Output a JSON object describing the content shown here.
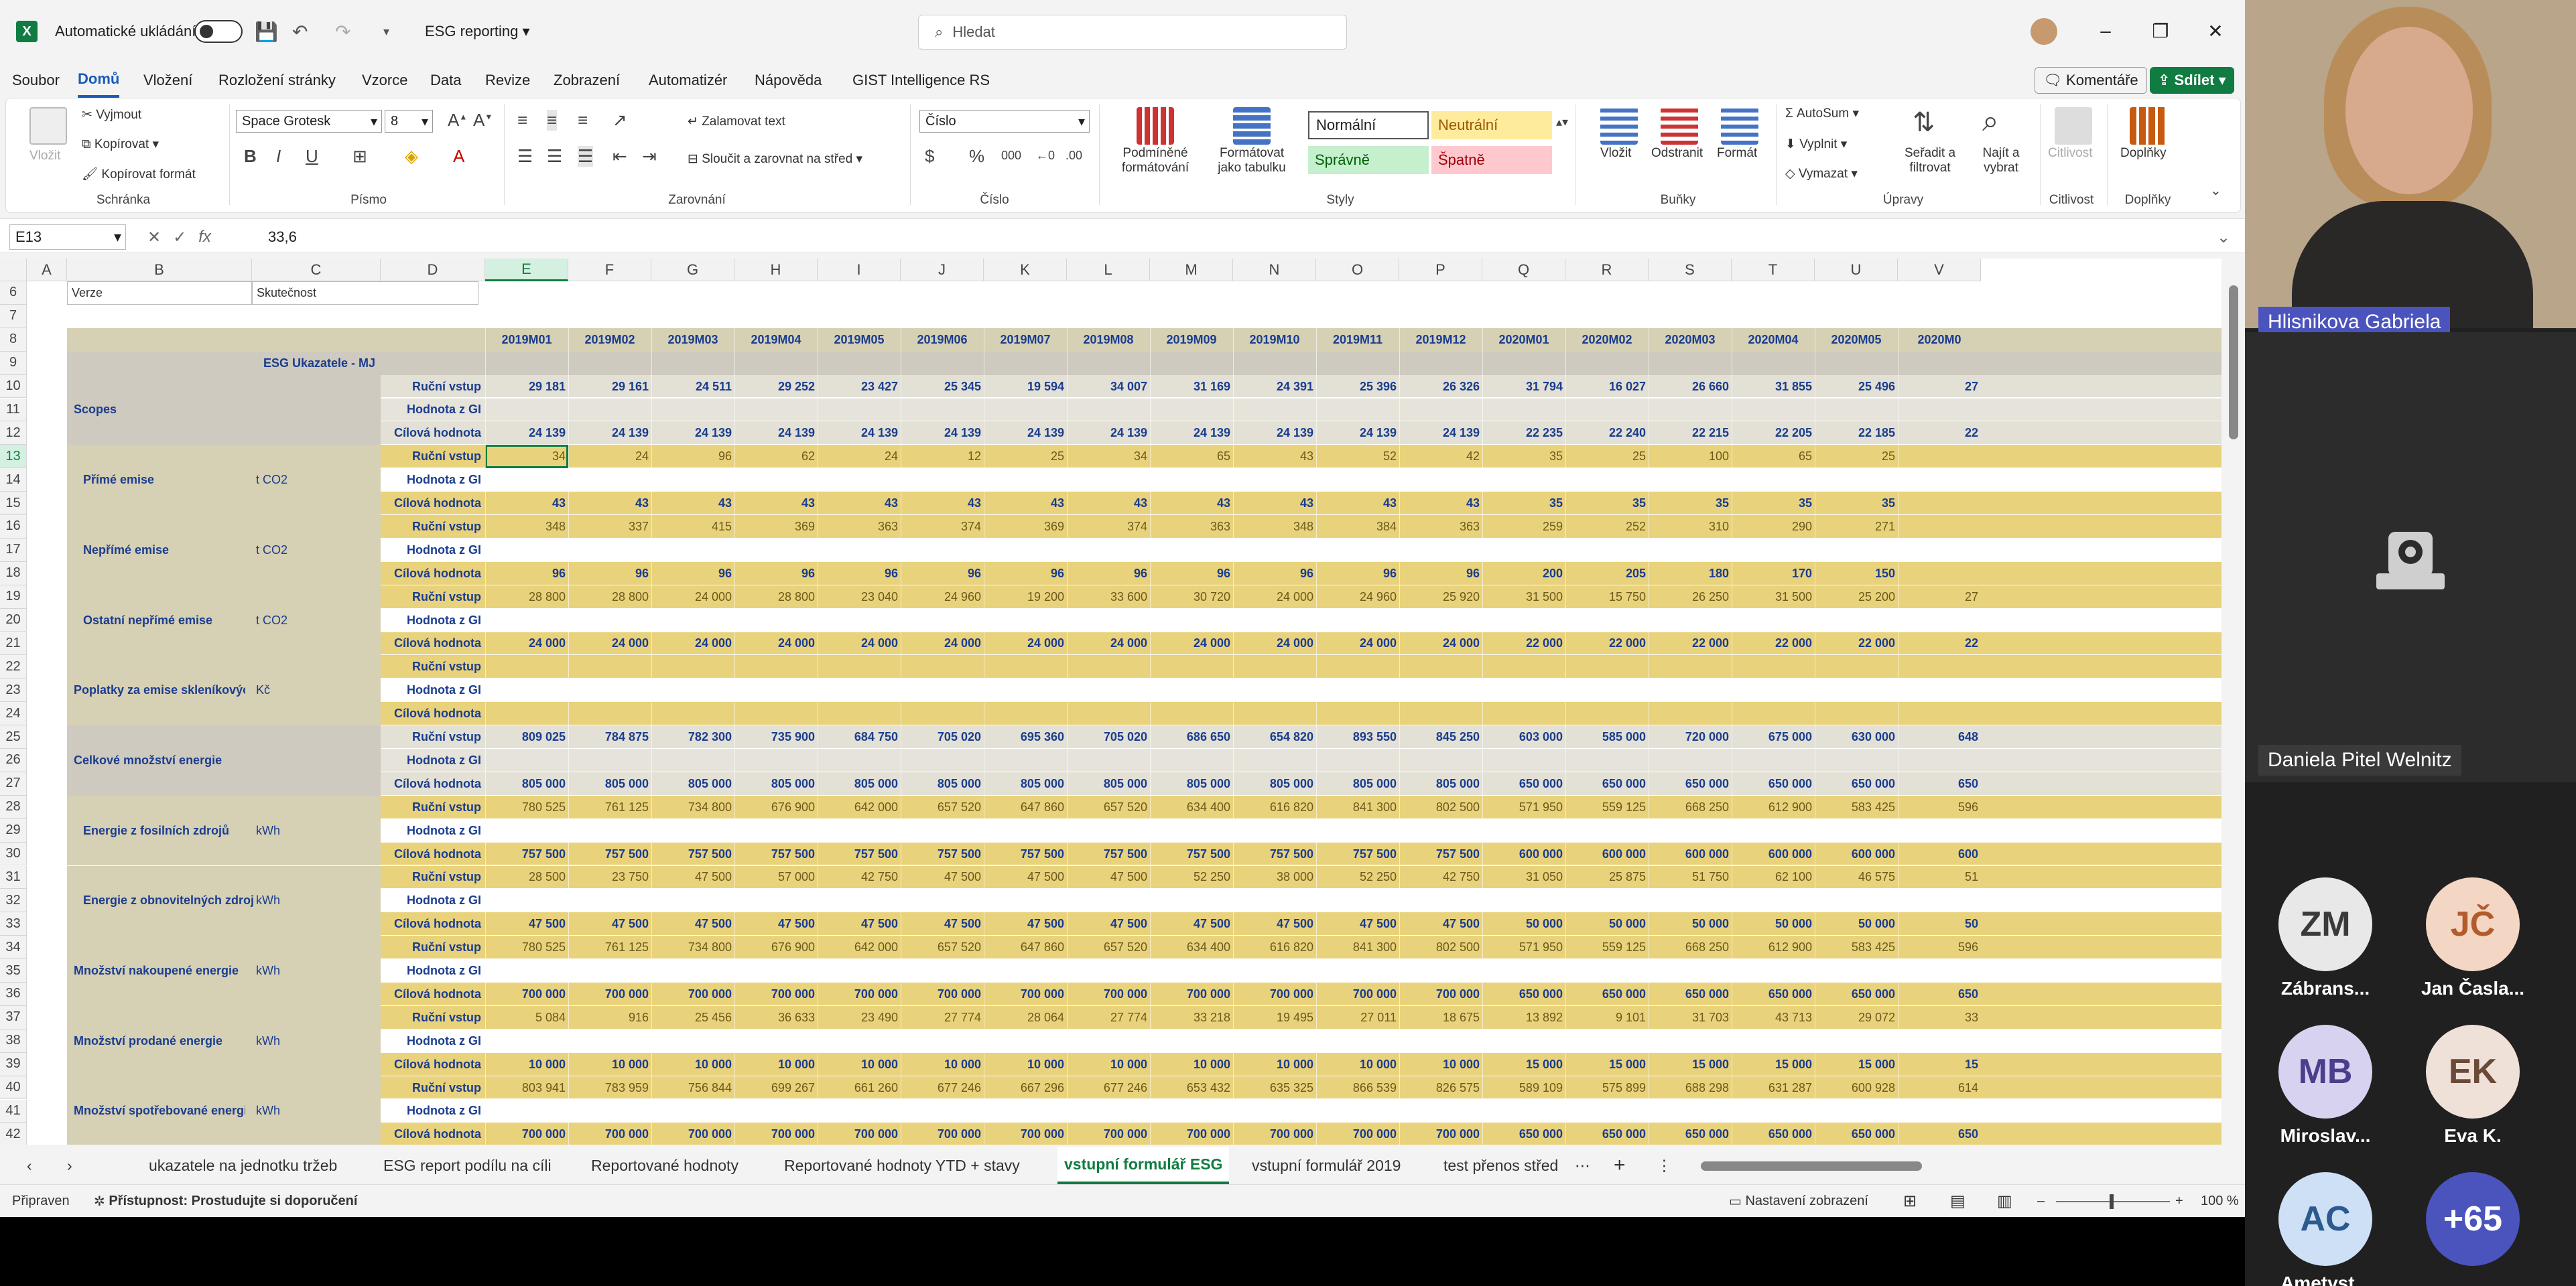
{
  "titlebar": {
    "autosave_label": "Automatické ukládání",
    "doc_title": "ESG reporting",
    "search_placeholder": "Hledat",
    "logo": "X"
  },
  "menu": [
    "Soubor",
    "Domů",
    "Vložení",
    "Rozložení stránky",
    "Vzorce",
    "Data",
    "Revize",
    "Zobrazení",
    "Automatizér",
    "Nápověda",
    "GIST Intelligence RS"
  ],
  "menu_right": {
    "comments": "Komentáře",
    "share": "Sdílet"
  },
  "ribbon": {
    "clipboard": {
      "paste": "Vložit",
      "cut": "Vyjmout",
      "copy": "Kopírovat",
      "format_painter": "Kopírovat formát",
      "group": "Schránka"
    },
    "font": {
      "name": "Space Grotesk",
      "size": "8",
      "group": "Písmo",
      "bold": "B",
      "italic": "I",
      "underline": "U"
    },
    "alignment": {
      "wrap": "Zalamovat text",
      "merge": "Sloučit a zarovnat na střed",
      "group": "Zarovnání"
    },
    "number": {
      "format": "Číslo",
      "currency": "$",
      "percent": "%",
      "thousands": "000",
      "group": "Číslo"
    },
    "styles": {
      "cond_format": "Podmíněné formátování",
      "as_table": "Formátovat jako tabulku",
      "normal": "Normální",
      "neutral": "Neutrální",
      "good": "Správně",
      "bad": "Špatně",
      "group": "Styly"
    },
    "cells": {
      "insert": "Vložit",
      "delete": "Odstranit",
      "format": "Formát",
      "group": "Buňky"
    },
    "editing": {
      "autosum": "AutoSum",
      "fill": "Vyplnit",
      "clear": "Vymazat",
      "sort": "Seřadit a filtrovat",
      "find": "Najít a vybrat",
      "group": "Úpravy"
    },
    "sensitivity": {
      "label": "Citlivost",
      "group": "Citlivost"
    },
    "addins": {
      "label": "Doplňky",
      "group": "Doplňky"
    }
  },
  "formula_bar": {
    "name_box": "E13",
    "fx": "fx",
    "formula": "33,6"
  },
  "grid": {
    "columns": [
      "A",
      "B",
      "C",
      "D",
      "E",
      "F",
      "G",
      "H",
      "I",
      "J",
      "K",
      "L",
      "M",
      "N",
      "O",
      "P",
      "Q",
      "R",
      "S",
      "T",
      "U",
      "V"
    ],
    "months": [
      "2019M01",
      "2019M02",
      "2019M03",
      "2019M04",
      "2019M05",
      "2019M06",
      "2019M07",
      "2019M08",
      "2019M09",
      "2019M10",
      "2019M11",
      "2019M12",
      "2020M01",
      "2020M02",
      "2020M03",
      "2020M04",
      "2020M05",
      "2020M0"
    ],
    "row6_b": "Verze",
    "row6_c": "Skutečnost",
    "row9_header": "ESG Ukazatele - MJ",
    "row_labels": [
      "Ruční vstup",
      "Hodnota z GI",
      "Cílová hodnota"
    ],
    "blocks": [
      {
        "name": "Scopes",
        "unit": "",
        "rows": [
          [
            "29 181",
            "29 161",
            "24 511",
            "29 252",
            "23 427",
            "25 345",
            "19 594",
            "34 007",
            "31 169",
            "24 391",
            "25 396",
            "26 326",
            "31 794",
            "16 027",
            "26 660",
            "31 855",
            "25 496",
            "27"
          ],
          [],
          [
            "24 139",
            "24 139",
            "24 139",
            "24 139",
            "24 139",
            "24 139",
            "24 139",
            "24 139",
            "24 139",
            "24 139",
            "24 139",
            "24 139",
            "22 235",
            "22 240",
            "22 215",
            "22 205",
            "22 185",
            "22"
          ]
        ]
      },
      {
        "name": "Přímé emise",
        "unit": "t CO2",
        "rows": [
          [
            "34",
            "24",
            "96",
            "62",
            "24",
            "12",
            "25",
            "34",
            "65",
            "43",
            "52",
            "42",
            "35",
            "25",
            "100",
            "65",
            "25",
            ""
          ],
          [],
          [
            "43",
            "43",
            "43",
            "43",
            "43",
            "43",
            "43",
            "43",
            "43",
            "43",
            "43",
            "43",
            "35",
            "35",
            "35",
            "35",
            "35",
            ""
          ]
        ]
      },
      {
        "name": "Nepřímé emise",
        "unit": "t CO2",
        "rows": [
          [
            "348",
            "337",
            "415",
            "369",
            "363",
            "374",
            "369",
            "374",
            "363",
            "348",
            "384",
            "363",
            "259",
            "252",
            "310",
            "290",
            "271",
            ""
          ],
          [],
          [
            "96",
            "96",
            "96",
            "96",
            "96",
            "96",
            "96",
            "96",
            "96",
            "96",
            "96",
            "96",
            "200",
            "205",
            "180",
            "170",
            "150",
            ""
          ]
        ]
      },
      {
        "name": "Ostatní nepřímé emise",
        "unit": "t CO2",
        "rows": [
          [
            "28 800",
            "28 800",
            "24 000",
            "28 800",
            "23 040",
            "24 960",
            "19 200",
            "33 600",
            "30 720",
            "24 000",
            "24 960",
            "25 920",
            "31 500",
            "15 750",
            "26 250",
            "31 500",
            "25 200",
            "27"
          ],
          [],
          [
            "24 000",
            "24 000",
            "24 000",
            "24 000",
            "24 000",
            "24 000",
            "24 000",
            "24 000",
            "24 000",
            "24 000",
            "24 000",
            "24 000",
            "22 000",
            "22 000",
            "22 000",
            "22 000",
            "22 000",
            "22"
          ]
        ]
      },
      {
        "name": "Poplatky za emise skleníkových plynů",
        "unit": "Kč",
        "rows": [
          [],
          [],
          []
        ]
      },
      {
        "name": "Celkové množství energie",
        "unit": "",
        "rows": [
          [
            "809 025",
            "784 875",
            "782 300",
            "735 900",
            "684 750",
            "705 020",
            "695 360",
            "705 020",
            "686 650",
            "654 820",
            "893 550",
            "845 250",
            "603 000",
            "585 000",
            "720 000",
            "675 000",
            "630 000",
            "648"
          ],
          [],
          [
            "805 000",
            "805 000",
            "805 000",
            "805 000",
            "805 000",
            "805 000",
            "805 000",
            "805 000",
            "805 000",
            "805 000",
            "805 000",
            "805 000",
            "650 000",
            "650 000",
            "650 000",
            "650 000",
            "650 000",
            "650"
          ]
        ]
      },
      {
        "name": "Energie z fosilních zdrojů",
        "unit": "kWh",
        "rows": [
          [
            "780 525",
            "761 125",
            "734 800",
            "676 900",
            "642 000",
            "657 520",
            "647 860",
            "657 520",
            "634 400",
            "616 820",
            "841 300",
            "802 500",
            "571 950",
            "559 125",
            "668 250",
            "612 900",
            "583 425",
            "596"
          ],
          [],
          [
            "757 500",
            "757 500",
            "757 500",
            "757 500",
            "757 500",
            "757 500",
            "757 500",
            "757 500",
            "757 500",
            "757 500",
            "757 500",
            "757 500",
            "600 000",
            "600 000",
            "600 000",
            "600 000",
            "600 000",
            "600"
          ]
        ]
      },
      {
        "name": "Energie z obnovitelných zdrojů",
        "unit": "kWh",
        "rows": [
          [
            "28 500",
            "23 750",
            "47 500",
            "57 000",
            "42 750",
            "47 500",
            "47 500",
            "47 500",
            "52 250",
            "38 000",
            "52 250",
            "42 750",
            "31 050",
            "25 875",
            "51 750",
            "62 100",
            "46 575",
            "51"
          ],
          [],
          [
            "47 500",
            "47 500",
            "47 500",
            "47 500",
            "47 500",
            "47 500",
            "47 500",
            "47 500",
            "47 500",
            "47 500",
            "47 500",
            "47 500",
            "50 000",
            "50 000",
            "50 000",
            "50 000",
            "50 000",
            "50"
          ]
        ]
      },
      {
        "name": "Množství nakoupené energie",
        "unit": "kWh",
        "rows": [
          [
            "780 525",
            "761 125",
            "734 800",
            "676 900",
            "642 000",
            "657 520",
            "647 860",
            "657 520",
            "634 400",
            "616 820",
            "841 300",
            "802 500",
            "571 950",
            "559 125",
            "668 250",
            "612 900",
            "583 425",
            "596"
          ],
          [],
          [
            "700 000",
            "700 000",
            "700 000",
            "700 000",
            "700 000",
            "700 000",
            "700 000",
            "700 000",
            "700 000",
            "700 000",
            "700 000",
            "700 000",
            "650 000",
            "650 000",
            "650 000",
            "650 000",
            "650 000",
            "650"
          ]
        ]
      },
      {
        "name": "Množství prodané energie",
        "unit": "kWh",
        "rows": [
          [
            "5 084",
            "916",
            "25 456",
            "36 633",
            "23 490",
            "27 774",
            "28 064",
            "27 774",
            "33 218",
            "19 495",
            "27 011",
            "18 675",
            "13 892",
            "9 101",
            "31 703",
            "43 713",
            "29 072",
            "33"
          ],
          [],
          [
            "10 000",
            "10 000",
            "10 000",
            "10 000",
            "10 000",
            "10 000",
            "10 000",
            "10 000",
            "10 000",
            "10 000",
            "10 000",
            "10 000",
            "15 000",
            "15 000",
            "15 000",
            "15 000",
            "15 000",
            "15"
          ]
        ]
      },
      {
        "name": "Množství spotřebované energie",
        "unit": "kWh",
        "rows": [
          [
            "803 941",
            "783 959",
            "756 844",
            "699 267",
            "661 260",
            "677 246",
            "667 296",
            "677 246",
            "653 432",
            "635 325",
            "866 539",
            "826 575",
            "589 109",
            "575 899",
            "688 298",
            "631 287",
            "600 928",
            "614"
          ],
          [],
          [
            "700 000",
            "700 000",
            "700 000",
            "700 000",
            "700 000",
            "700 000",
            "700 000",
            "700 000",
            "700 000",
            "700 000",
            "700 000",
            "700 000",
            "650 000",
            "650 000",
            "650 000",
            "650 000",
            "650 000",
            "650"
          ]
        ]
      }
    ]
  },
  "sheet_tabs": [
    "ukazatele na jednotku tržeb",
    "ESG report podílu na cíli",
    "Reportované hodnoty",
    "Reportované hodnoty YTD + stavy",
    "vstupní formulář ESG",
    "vstupní formulář 2019",
    "test přenos střed"
  ],
  "active_tab": "vstupní formulář ESG",
  "status": {
    "ready": "Připraven",
    "accessibility": "Přístupnost: Prostudujte si doporučení",
    "display_settings": "Nastavení zobrazení",
    "zoom": "100 %"
  },
  "meeting": {
    "main_speaker": "Hlisnikova Gabriela",
    "second_tile": "Daniela Pitel Welnitz",
    "participants": [
      {
        "initials": "ZM",
        "name": "Zábrans...",
        "color": "#e8e8e8",
        "text": "#3a3a3a"
      },
      {
        "initials": "JČ",
        "name": "Jan Časla...",
        "color": "#f3d6c4",
        "text": "#b25b2c"
      },
      {
        "initials": "MB",
        "name": "Miroslav...",
        "color": "#d7d2ef",
        "text": "#4a3f8c"
      },
      {
        "initials": "EK",
        "name": "Eva K.",
        "color": "#efe1d8",
        "text": "#6b4a3a"
      },
      {
        "initials": "AC",
        "name": "Ametyst...",
        "color": "#cde0f5",
        "text": "#2b5a8f"
      },
      {
        "initials": "+65",
        "name": "",
        "color": "#4b53bc",
        "text": "#ffffff"
      }
    ]
  }
}
